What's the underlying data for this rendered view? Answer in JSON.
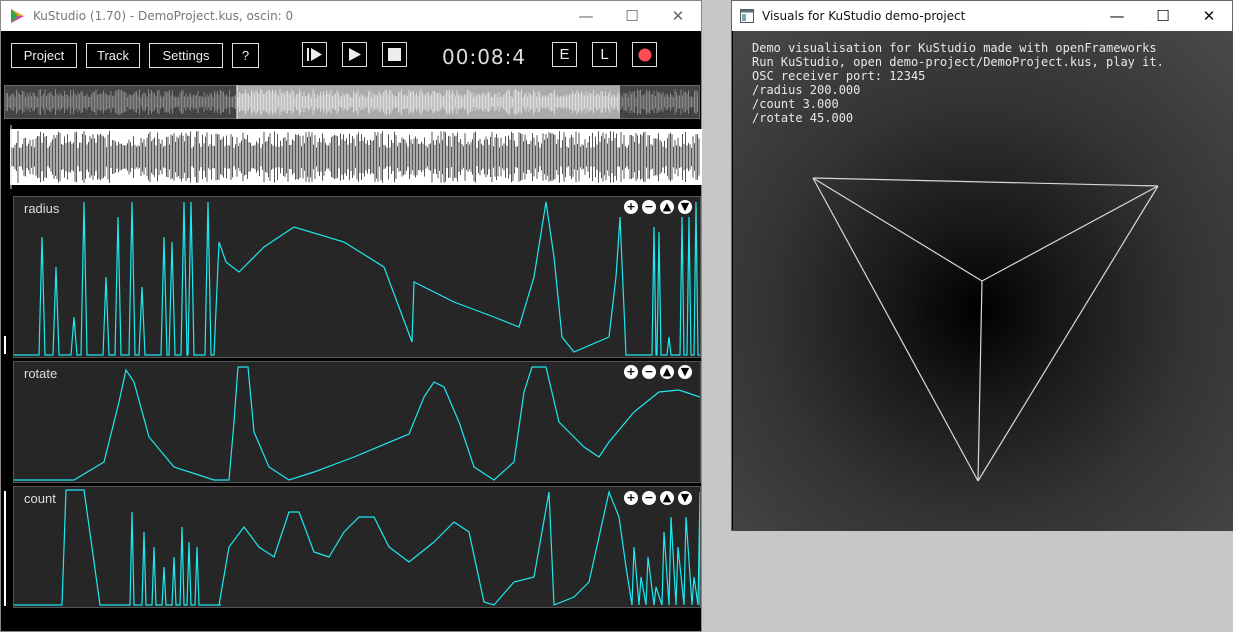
{
  "kustudio": {
    "title": "KuStudio (1.70) - DemoProject.kus, oscin: 0",
    "window_controls": {
      "minimize": "—",
      "maximize": "☐",
      "close": "✕"
    },
    "menu": {
      "project": "Project",
      "track": "Track",
      "settings": "Settings",
      "help": "?"
    },
    "transport": {
      "time": "00:08:4",
      "e_label": "E",
      "l_label": "L"
    },
    "tracks": [
      {
        "name": "radius"
      },
      {
        "name": "rotate"
      },
      {
        "name": "count"
      }
    ],
    "track_controls": {
      "add": "+",
      "remove": "−",
      "up": "▲",
      "down": "▼"
    },
    "colors": {
      "curve": "#1ee8f0",
      "record": "#ff4b55",
      "track_bg": "#262626"
    }
  },
  "visuals": {
    "title": "Visuals for KuStudio demo-project",
    "window_controls": {
      "minimize": "—",
      "maximize": "☐",
      "close": "✕"
    },
    "lines": [
      "Demo visualisation for KuStudio made with openFrameworks",
      "Run KuStudio, open demo-project/DemoProject.kus, play it.",
      "OSC receiver port: 12345",
      "/radius 200.000",
      "/count 3.000",
      "/rotate 45.000"
    ]
  }
}
